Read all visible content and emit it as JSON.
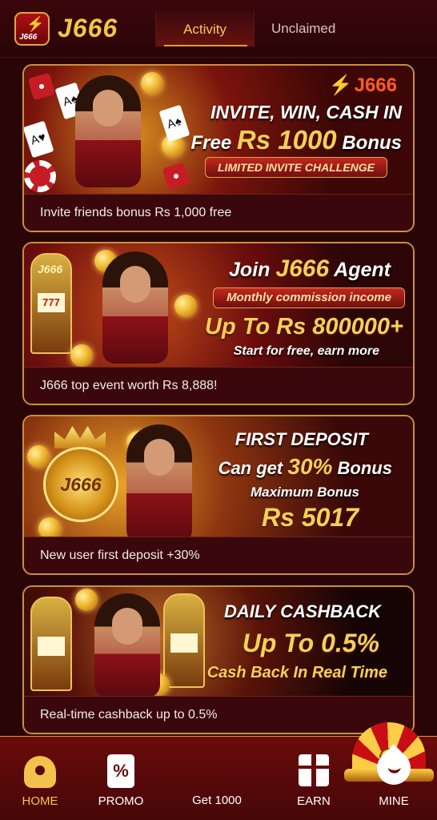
{
  "header": {
    "brand": "J666",
    "logo_text": "J666",
    "tabs": {
      "activity": "Activity",
      "unclaimed": "Unclaimed"
    }
  },
  "cards": [
    {
      "brand": "J666",
      "headline": "INVITE, WIN, CASH IN",
      "bonus_prefix": "Free",
      "bonus_amount": "Rs 1000",
      "bonus_suffix": "Bonus",
      "pill": "LIMITED INVITE CHALLENGE",
      "caption": "Invite friends bonus Rs 1,000 free"
    },
    {
      "slot_sign": "J666",
      "slot_screen": "777",
      "headline_prefix": "Join",
      "headline_brand": "J666",
      "headline_suffix": "Agent",
      "pill": "Monthly commission income",
      "amount": "Up To Rs 800000+",
      "subtext": "Start for free, earn more",
      "caption": "J666 top event worth Rs 8,888!"
    },
    {
      "emblem": "J666",
      "headline": "FIRST DEPOSIT",
      "bonus_prefix": "Can get",
      "bonus_percent": "30%",
      "bonus_suffix": "Bonus",
      "max_label": "Maximum Bonus",
      "max_amount": "Rs 5017",
      "caption": "New user first deposit +30%"
    },
    {
      "headline": "DAILY CASHBACK",
      "amount": "Up To 0.5%",
      "subtext": "Cash Back In Real Time",
      "caption": "Real-time cashback up to 0.5%"
    }
  ],
  "bottom_nav": [
    {
      "label": "HOME",
      "icon": "spade-home-icon",
      "active": true
    },
    {
      "label": "PROMO",
      "icon": "promo-ticket-icon",
      "active": false
    },
    {
      "label": "Get 1000",
      "icon": "lucky-wheel-icon",
      "active": false
    },
    {
      "label": "EARN",
      "icon": "gift-icon",
      "active": false
    },
    {
      "label": "MINE",
      "icon": "profile-drop-icon",
      "active": false
    }
  ],
  "colors": {
    "background": "#2a0508",
    "gold": "#f3d05a",
    "accent_red": "#c2281e",
    "card_border": "#c9923a"
  }
}
